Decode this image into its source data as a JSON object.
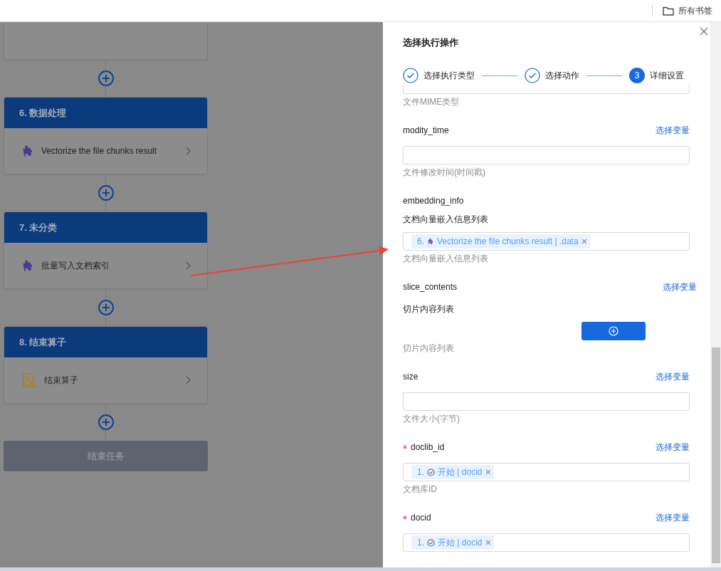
{
  "browser_bar": {
    "bookmarks_label": "所有书签"
  },
  "flow": {
    "nodes": [
      {
        "kind": "partial"
      },
      {
        "kind": "step",
        "title": "6. 数据处理",
        "item": {
          "kind": "plugin",
          "label": "Vectorize the file chunks result"
        }
      },
      {
        "kind": "step",
        "title": "7. 未分类",
        "item": {
          "kind": "plugin",
          "label": "批量写入文档索引"
        }
      },
      {
        "kind": "step",
        "title": "8. 结束算子",
        "item": {
          "kind": "end",
          "label": "结束算子"
        }
      },
      {
        "kind": "end",
        "title": "结束任务"
      }
    ]
  },
  "drawer": {
    "title": "选择执行操作",
    "steps": [
      {
        "label": "选择执行类型",
        "done": true
      },
      {
        "label": "选择动作",
        "done": true
      },
      {
        "label": "详细设置",
        "done": false,
        "number": "3"
      }
    ],
    "fields": [
      {
        "kind": "input",
        "hint": "文件MIME类型"
      },
      {
        "kind": "input",
        "name": "modity_time",
        "link": "选择变量",
        "hint": "文件修改时间(时间戳)"
      },
      {
        "kind": "tags",
        "name": "embedding_info",
        "label": "文档向量嵌入信息列表",
        "tags": [
          {
            "kind": "plugin",
            "index": "6.",
            "text": "Vectorize the file chunks result | .data"
          }
        ],
        "hint": "文档向量嵌入信息列表"
      },
      {
        "kind": "add",
        "name": "slice_contents",
        "link": "选择变量",
        "label": "切片内容列表",
        "hint": "切片内容列表"
      },
      {
        "kind": "input",
        "name": "size",
        "link": "选择变量",
        "hint": "文件大小(字节)"
      },
      {
        "kind": "tags",
        "name": "doclib_id",
        "required": true,
        "link": "选择变量",
        "tags": [
          {
            "kind": "start",
            "index": "1.",
            "text": "开始 | docid"
          }
        ],
        "hint": "文档库ID"
      },
      {
        "kind": "tags",
        "name": "docid",
        "required": true,
        "link": "选择变量",
        "tags": [
          {
            "kind": "start",
            "index": "1.",
            "text": "开始 | docid"
          }
        ]
      }
    ]
  }
}
